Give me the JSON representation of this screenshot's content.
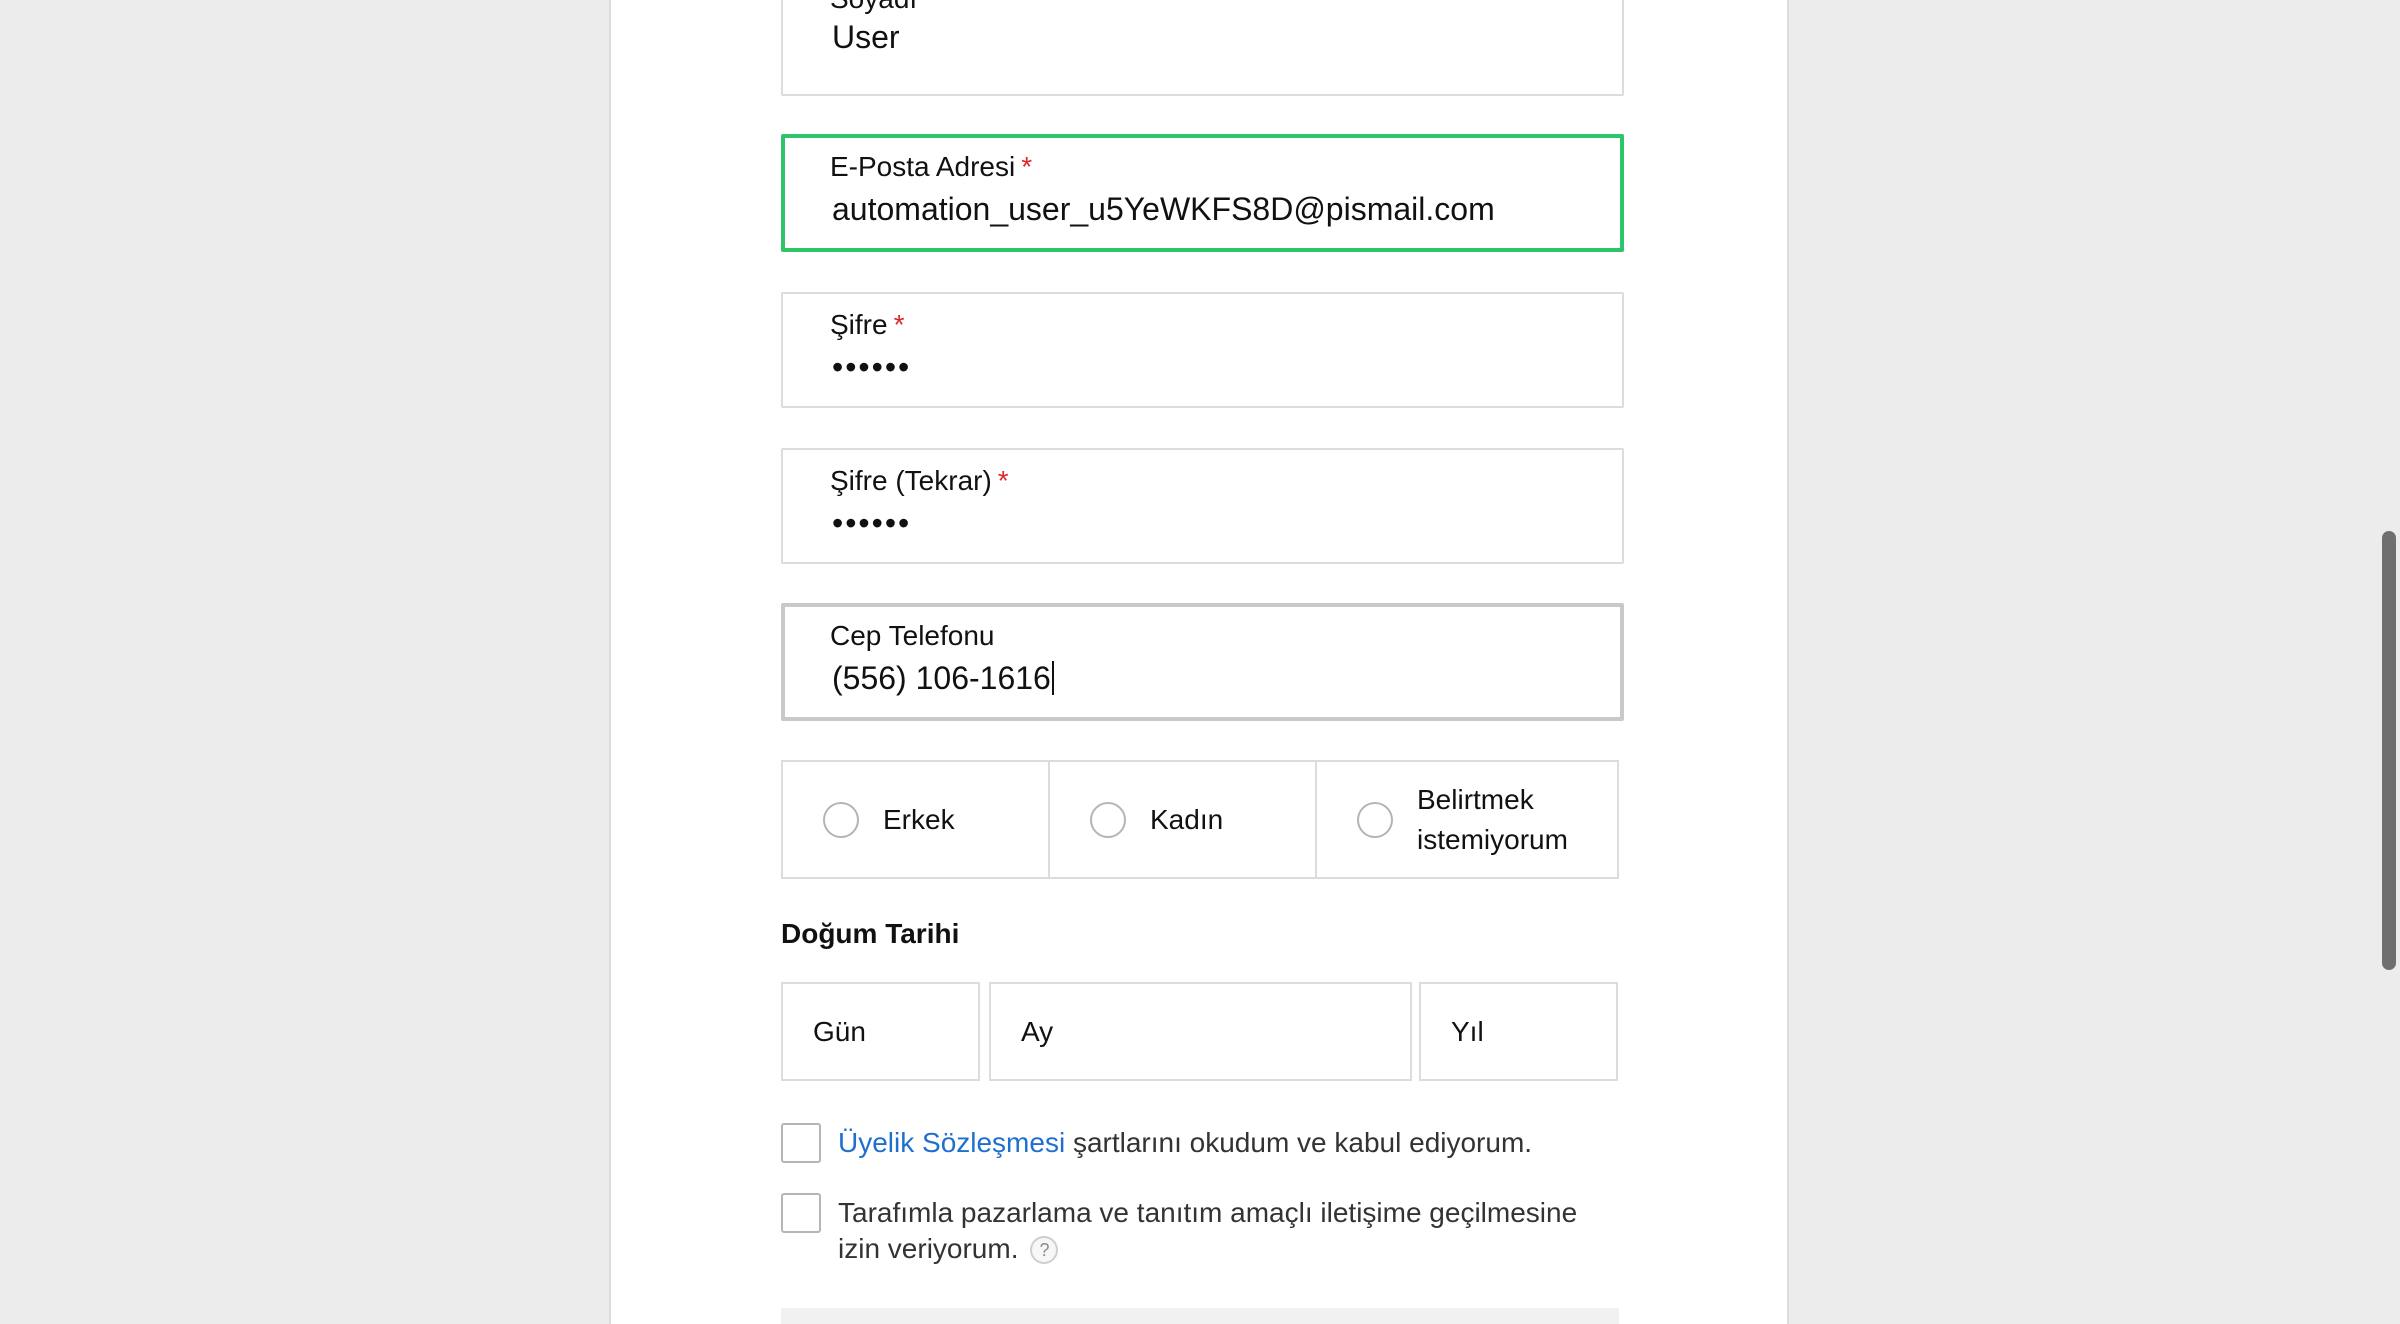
{
  "form": {
    "surname": {
      "label": "Soyadı",
      "required_mark": "*",
      "value": "User"
    },
    "email": {
      "label": "E-Posta Adresi",
      "required_mark": "*",
      "value": "automation_user_u5YeWKFS8D@pismail.com"
    },
    "password": {
      "label": "Şifre",
      "required_mark": "*",
      "value": "••••••"
    },
    "password_repeat": {
      "label": "Şifre (Tekrar)",
      "required_mark": "*",
      "value": "••••••"
    },
    "phone": {
      "label": "Cep Telefonu",
      "value": "(556) 106-1616"
    },
    "gender": {
      "options": [
        {
          "label": "Erkek",
          "selected": false
        },
        {
          "label": "Kadın",
          "selected": false
        },
        {
          "label": "Belirtmek istemiyorum",
          "selected": false
        }
      ]
    },
    "birth_date": {
      "title": "Doğum Tarihi",
      "day_placeholder": "Gün",
      "month_placeholder": "Ay",
      "year_placeholder": "Yıl"
    },
    "agreement": {
      "link_text": "Üyelik Sözleşmesi",
      "text": "şartlarını okudum ve kabul ediyorum.",
      "checked": false
    },
    "marketing": {
      "text": "Tarafımla pazarlama ve tanıtım amaçlı iletişime geçilmesine izin veriyorum.",
      "help_icon_text": "?",
      "checked": false
    }
  },
  "colors": {
    "focused_border": "#2ec46a",
    "required_mark": "#e0262b",
    "link": "#1f6fd1",
    "page_background": "#ececec"
  },
  "icons": {
    "radio": "radio-circle-icon",
    "checkbox": "checkbox-icon",
    "help": "question-mark-icon"
  }
}
